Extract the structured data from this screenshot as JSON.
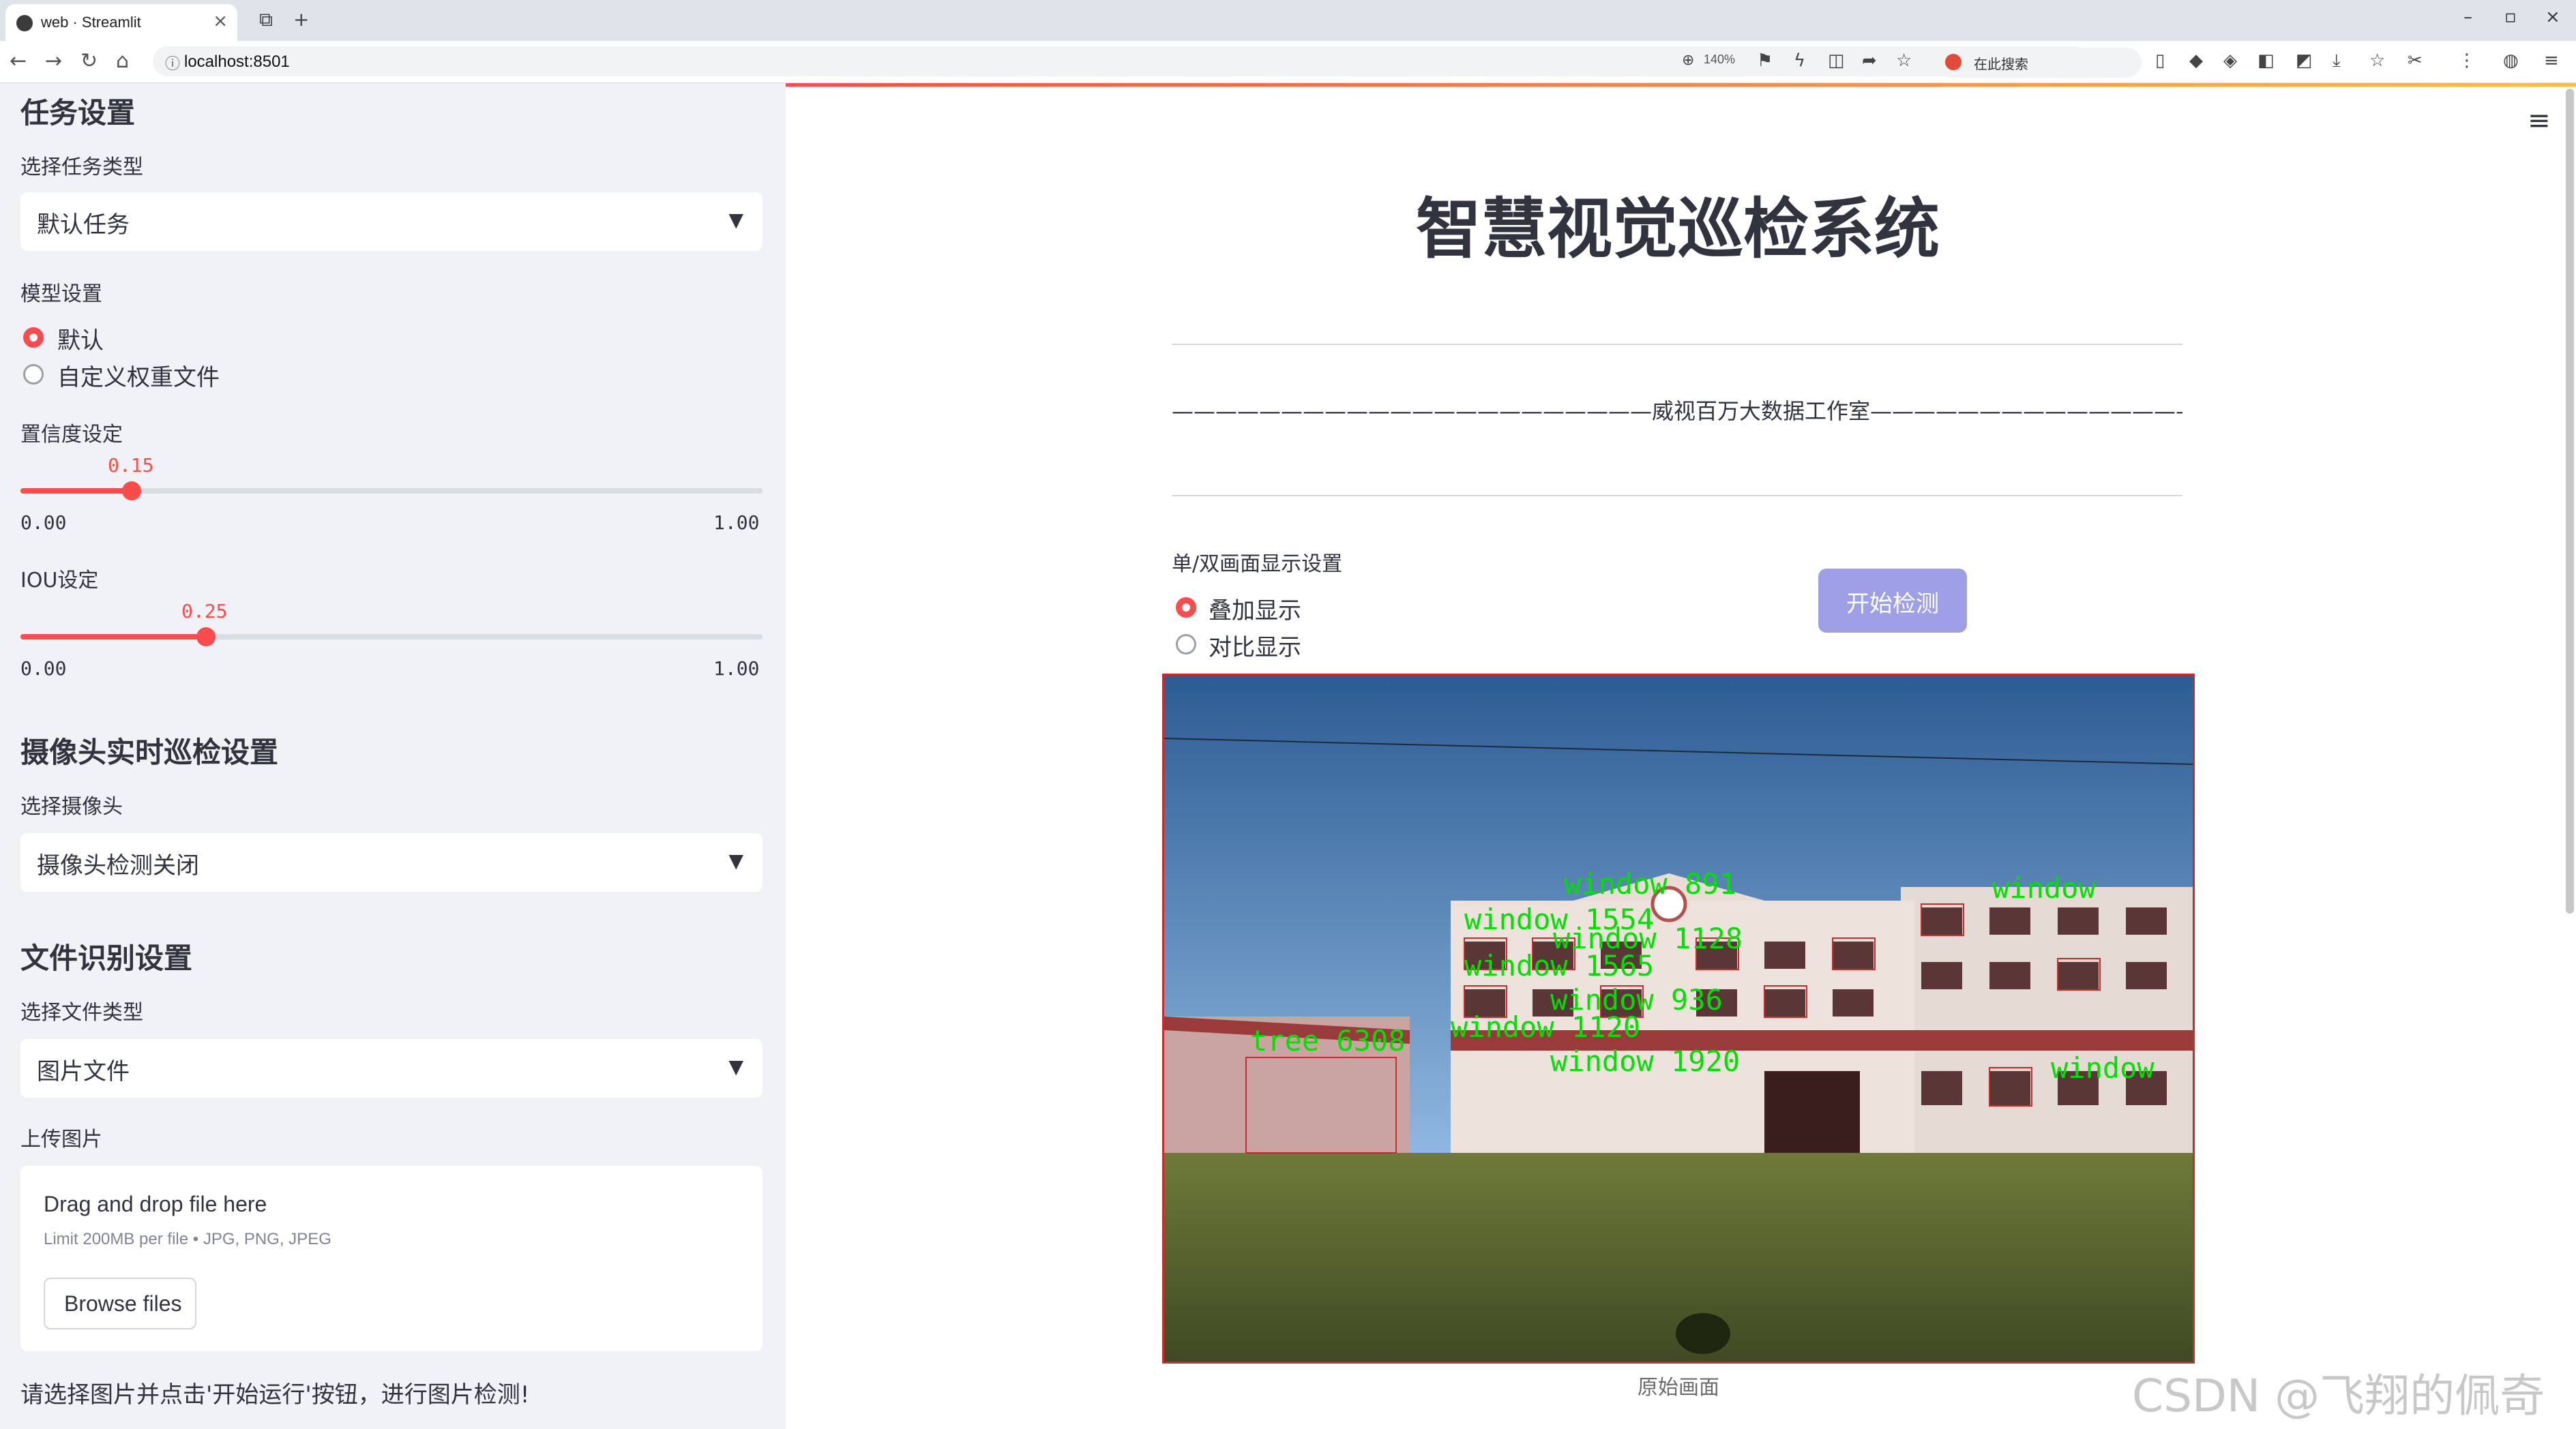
{
  "browser": {
    "tab_title": "web · Streamlit",
    "url": "localhost:8501",
    "zoom": "140%",
    "search_placeholder": "在此搜索"
  },
  "sidebar": {
    "task_section_title": "任务设置",
    "task_type_label": "选择任务类型",
    "task_type_value": "默认任务",
    "model_label": "模型设置",
    "model_options": [
      "默认",
      "自定义权重文件"
    ],
    "model_selected": "默认",
    "confidence": {
      "label": "置信度设定",
      "value": "0.15",
      "min": "0.00",
      "max": "1.00",
      "fraction": 0.15
    },
    "iou": {
      "label": "IOU设定",
      "value": "0.25",
      "min": "0.00",
      "max": "1.00",
      "fraction": 0.25
    },
    "camera_section_title": "摄像头实时巡检设置",
    "camera_label": "选择摄像头",
    "camera_value": "摄像头检测关闭",
    "file_section_title": "文件识别设置",
    "file_type_label": "选择文件类型",
    "file_type_value": "图片文件",
    "upload_label": "上传图片",
    "upload_drag_text": "Drag and drop file here",
    "upload_limit": "Limit 200MB per file • JPG, PNG, JPEG",
    "browse_button": "Browse files",
    "hint": "请选择图片并点击'开始运行'按钮，进行图片检测!"
  },
  "main": {
    "title": "智慧视觉巡检系统",
    "studio_line": "——————————————————————威视百万大数据工作室——————————————————————",
    "display_label": "单/双画面显示设置",
    "display_options": [
      "叠加显示",
      "对比显示"
    ],
    "display_selected": "叠加显示",
    "start_button": "开始检测",
    "image_caption": "原始画面",
    "detections": [
      "window 891",
      "window 1554",
      "window 1128",
      "window 1565",
      "window 936",
      "window 1120",
      "window 1920",
      "window",
      "tree 6308"
    ],
    "colors": {
      "accent": "#ff4b4b",
      "button": "#9f9fe8",
      "detection": "#00e000",
      "sidebar_bg": "#f0f2f6"
    }
  },
  "watermark": "CSDN @飞翔的佩奇"
}
